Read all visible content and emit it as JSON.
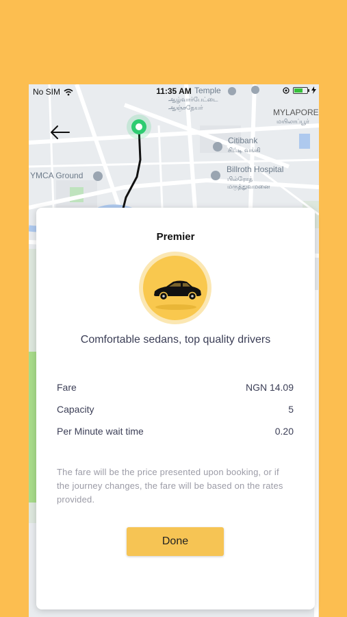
{
  "status_bar": {
    "carrier": "No SIM",
    "time": "11:35 AM"
  },
  "map": {
    "labels": {
      "temple": "Temple",
      "temple_tamil1": "ஆழ்வார்பேட்டை",
      "temple_tamil2": "ஆஞ்சநேயர்",
      "mylapore": "MYLAPORE",
      "mylapore_tamil": "மயிலாப்பூர்",
      "citibank": "Citibank",
      "citibank_tamil": "சிட்டி வங்கி",
      "ymca": "YMCA Ground",
      "hospital": "Billroth Hospital",
      "hospital_tamil1": "பில்ரோத்",
      "hospital_tamil2": "மருத்துவமனை"
    }
  },
  "card": {
    "title": "Premier",
    "description": "Comfortable sedans, top quality drivers",
    "details": [
      {
        "label": "Fare",
        "value": "NGN 14.09"
      },
      {
        "label": "Capacity",
        "value": "5"
      },
      {
        "label": "Per Minute wait time",
        "value": "0.20"
      }
    ],
    "note": "The fare will be the price presented upon booking, or if the journey changes, the fare will be based on the rates provided.",
    "done_label": "Done"
  },
  "colors": {
    "background": "#FCBE50",
    "accent": "#F6C454",
    "route": "#111111",
    "pin": "#2ECC71"
  },
  "icons": [
    "wifi-icon",
    "location-icon",
    "battery-icon",
    "charging-icon",
    "back-arrow-icon",
    "car-icon",
    "pin-icon"
  ]
}
